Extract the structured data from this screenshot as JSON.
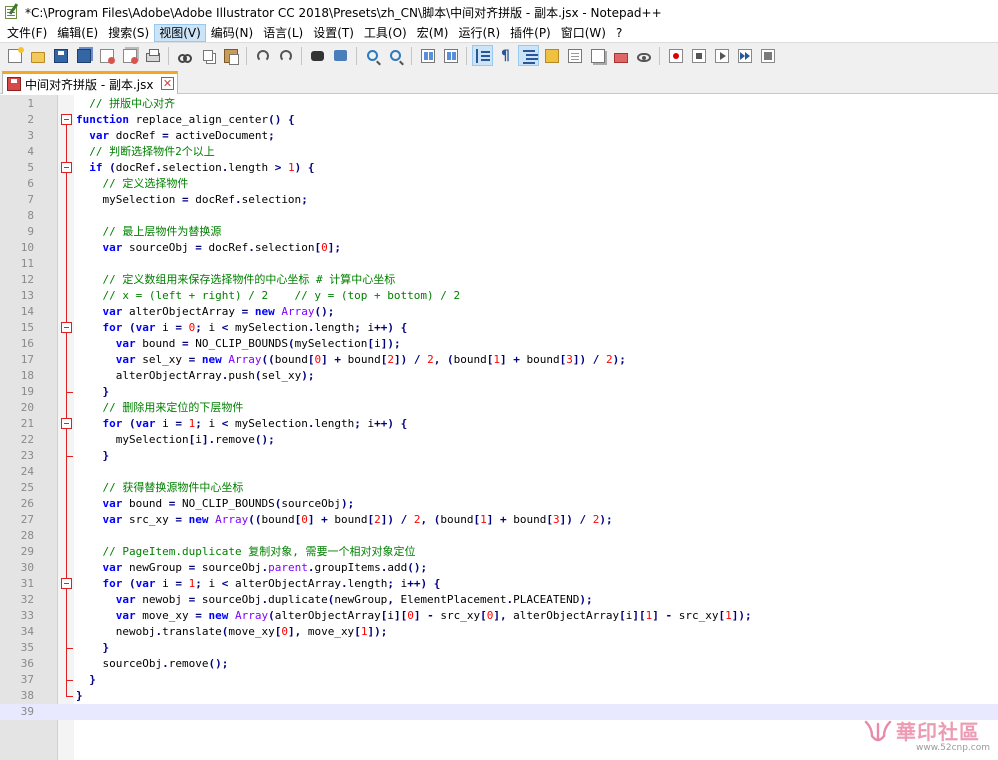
{
  "window": {
    "title": "*C:\\Program Files\\Adobe\\Adobe Illustrator CC 2018\\Presets\\zh_CN\\脚本\\中间对齐拼版 - 副本.jsx - Notepad++"
  },
  "menu": [
    "文件(F)",
    "编辑(E)",
    "搜索(S)",
    "视图(V)",
    "编码(N)",
    "语言(L)",
    "设置(T)",
    "工具(O)",
    "宏(M)",
    "运行(R)",
    "插件(P)",
    "窗口(W)",
    "?"
  ],
  "menu_active_index": 3,
  "toolbar": {
    "icons": [
      "new-file-icon",
      "open-file-icon",
      "save-icon",
      "save-all-icon",
      "close-icon",
      "close-all-icon",
      "print-icon",
      "cut-icon",
      "copy-icon",
      "paste-icon",
      "undo-icon",
      "redo-icon",
      "find-icon",
      "replace-icon",
      "zoom-in-icon",
      "zoom-out-icon",
      "sync-vertical-icon",
      "sync-horizontal-icon",
      "word-wrap-icon",
      "show-all-chars-icon",
      "indent-guide-icon",
      "user-language-icon",
      "document-map-icon",
      "function-list-icon",
      "folder-workspace-icon",
      "monitoring-icon",
      "record-macro-icon",
      "stop-macro-icon",
      "play-macro-icon",
      "run-macro-multiple-icon",
      "save-macro-icon"
    ],
    "selected": [
      "word-wrap-icon",
      "indent-guide-icon"
    ]
  },
  "tab": {
    "label": "中间对齐拼版 - 副本.jsx",
    "close_glyph": "✕"
  },
  "code_lines": [
    "  // 拼版中心对齐",
    "function replace_align_center() {",
    "  var docRef = activeDocument;",
    "  // 判断选择物件2个以上",
    "  if (docRef.selection.length > 1) {",
    "    // 定义选择物件",
    "    mySelection = docRef.selection;",
    "",
    "    // 最上层物件为替换源",
    "    var sourceObj = docRef.selection[0];",
    "",
    "    // 定义数组用来保存选择物件的中心坐标 # 计算中心坐标",
    "    // x = (left + right) / 2    // y = (top + bottom) / 2",
    "    var alterObjectArray = new Array();",
    "    for (var i = 0; i < mySelection.length; i++) {",
    "      var bound = NO_CLIP_BOUNDS(mySelection[i]);",
    "      var sel_xy = new Array((bound[0] + bound[2]) / 2, (bound[1] + bound[3]) / 2);",
    "      alterObjectArray.push(sel_xy);",
    "    }",
    "    // 删除用来定位的下层物件",
    "    for (var i = 1; i < mySelection.length; i++) {",
    "      mySelection[i].remove();",
    "    }",
    "",
    "    // 获得替换源物件中心坐标",
    "    var bound = NO_CLIP_BOUNDS(sourceObj);",
    "    var src_xy = new Array((bound[0] + bound[2]) / 2, (bound[1] + bound[3]) / 2);",
    "",
    "    // PageItem.duplicate 复制对象, 需要一个相对对象定位",
    "    var newGroup = sourceObj.parent.groupItems.add();",
    "    for (var i = 1; i < alterObjectArray.length; i++) {",
    "      var newobj = sourceObj.duplicate(newGroup, ElementPlacement.PLACEATEND);",
    "      var move_xy = new Array(alterObjectArray[i][0] - src_xy[0], alterObjectArray[i][1] - src_xy[1]);",
    "      newobj.translate(move_xy[0], move_xy[1]);",
    "    }",
    "    sourceObj.remove();",
    "  }",
    "}",
    ""
  ],
  "fold_starts": [
    2,
    5,
    15,
    21,
    31
  ],
  "fold_ends": [
    19,
    23,
    35,
    37,
    38
  ],
  "current_line": 39,
  "watermark": {
    "title": "華印社區",
    "url": "www.52cnp.com",
    "color": "#e88aa8"
  },
  "colors": {
    "keyword": "#0000ff",
    "comment": "#008000",
    "number": "#ff0000",
    "operator": "#000080",
    "builtin": "#8000ff",
    "fold_marker": "#e02020",
    "tab_accent": "#f5a623",
    "current_line_bg": "#e8e8ff"
  }
}
